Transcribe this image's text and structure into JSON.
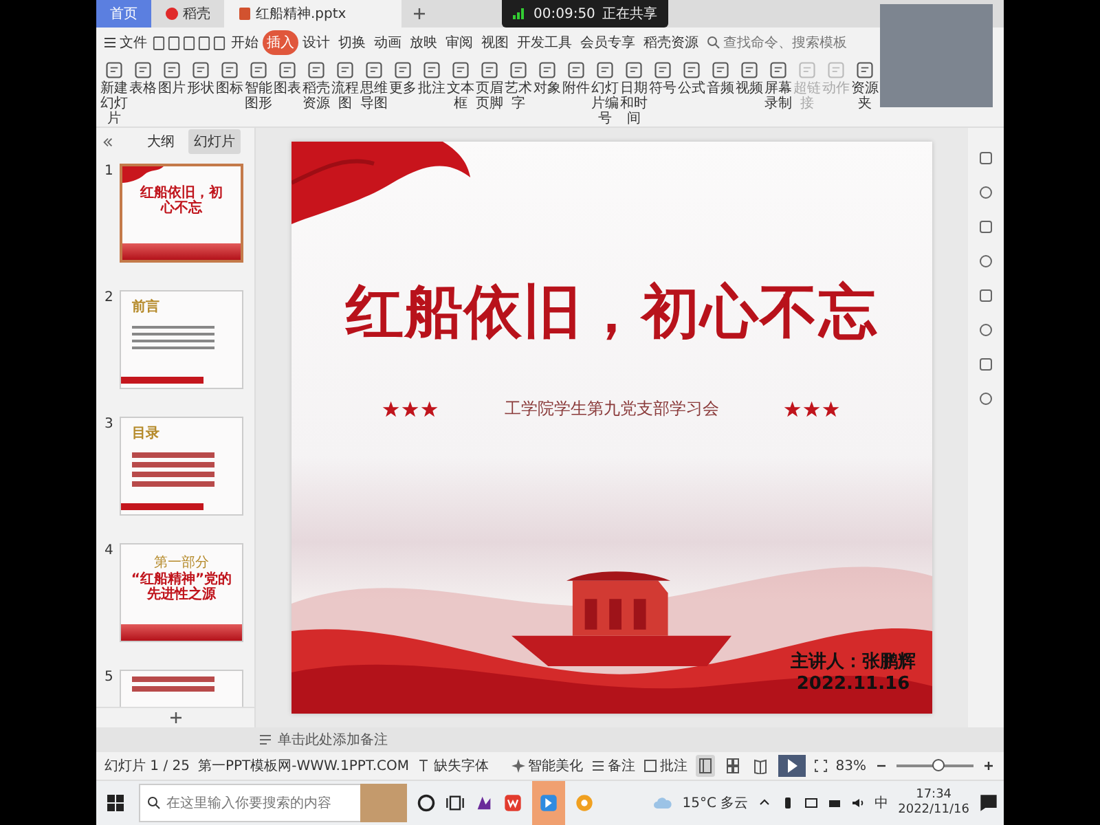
{
  "tabs": [
    {
      "label": "首页",
      "kind": "home",
      "selected": false
    },
    {
      "label": "稻壳",
      "kind": "docer",
      "selected": false
    },
    {
      "label": "红船精神.pptx",
      "kind": "file",
      "selected": true
    }
  ],
  "recording": {
    "time": "00:09:50",
    "status": "正在共享"
  },
  "file_menu": "文件",
  "menu": [
    {
      "label": "开始",
      "selected": false
    },
    {
      "label": "插入",
      "selected": true
    },
    {
      "label": "设计",
      "selected": false
    },
    {
      "label": "切换",
      "selected": false
    },
    {
      "label": "动画",
      "selected": false
    },
    {
      "label": "放映",
      "selected": false
    },
    {
      "label": "审阅",
      "selected": false
    },
    {
      "label": "视图",
      "selected": false
    },
    {
      "label": "开发工具",
      "selected": false
    },
    {
      "label": "会员专享",
      "selected": false
    },
    {
      "label": "稻壳资源",
      "selected": false
    }
  ],
  "search": {
    "placeholder": "查找命令、搜索模板"
  },
  "ribbon": [
    {
      "label": "新建幻灯片",
      "disabled": false
    },
    {
      "label": "表格",
      "disabled": false
    },
    {
      "label": "图片",
      "disabled": false
    },
    {
      "label": "形状",
      "disabled": false
    },
    {
      "label": "图标",
      "disabled": false
    },
    {
      "label": "智能图形",
      "disabled": false
    },
    {
      "label": "图表",
      "disabled": false
    },
    {
      "label": "稻壳资源",
      "disabled": false
    },
    {
      "label": "流程图",
      "disabled": false
    },
    {
      "label": "思维导图",
      "disabled": false
    },
    {
      "label": "更多",
      "disabled": false
    },
    {
      "label": "批注",
      "disabled": false
    },
    {
      "label": "文本框",
      "disabled": false
    },
    {
      "label": "页眉页脚",
      "disabled": false
    },
    {
      "label": "艺术字",
      "disabled": false
    },
    {
      "label": "对象",
      "disabled": false
    },
    {
      "label": "附件",
      "disabled": false
    },
    {
      "label": "幻灯片编号",
      "disabled": false
    },
    {
      "label": "日期和时间",
      "disabled": false
    },
    {
      "label": "符号",
      "disabled": false
    },
    {
      "label": "公式",
      "disabled": false
    },
    {
      "label": "音频",
      "disabled": false
    },
    {
      "label": "视频",
      "disabled": false
    },
    {
      "label": "屏幕录制",
      "disabled": false
    },
    {
      "label": "超链接",
      "disabled": true
    },
    {
      "label": "动作",
      "disabled": true
    },
    {
      "label": "资源夹",
      "disabled": false
    }
  ],
  "panel_tabs": [
    {
      "label": "大纲",
      "selected": false
    },
    {
      "label": "幻灯片",
      "selected": true
    }
  ],
  "thumbnails": [
    {
      "number": "1",
      "kind": "cover",
      "selected": true,
      "title": "红船依旧，初心不忘"
    },
    {
      "number": "2",
      "kind": "preface",
      "selected": false,
      "title": "前言"
    },
    {
      "number": "3",
      "kind": "contents",
      "selected": false,
      "title": "目录"
    },
    {
      "number": "4",
      "kind": "section",
      "selected": false,
      "caption": "第一部分",
      "title": "“红船精神”党的先进性之源"
    },
    {
      "number": "5",
      "kind": "list",
      "selected": false
    }
  ],
  "slide": {
    "title": "红船依旧，初心不忘",
    "subtitle": "工学院学生第九党支部学习会",
    "presenter": "主讲人：张鹏辉",
    "date": "2022.11.16"
  },
  "notes": {
    "placeholder": "单击此处添加备注"
  },
  "status_bar": {
    "slide_count": "幻灯片 1 / 25",
    "template": "第一PPT模板网-WWW.1PPT.COM",
    "missing_fonts": "缺失字体",
    "beautify": "智能美化",
    "notes": "备注",
    "comments": "批注",
    "views": [
      {
        "kind": "normal",
        "selected": true
      },
      {
        "kind": "sorter",
        "selected": false
      },
      {
        "kind": "reading",
        "selected": false
      }
    ],
    "zoom": "83%",
    "zoom_slider": {
      "level": 0.55
    }
  },
  "taskbar": {
    "search_placeholder": "在这里输入你要搜索的内容",
    "weather": "15°C 多云",
    "ime": "中",
    "time": "17:34",
    "date": "2022/11/16"
  }
}
